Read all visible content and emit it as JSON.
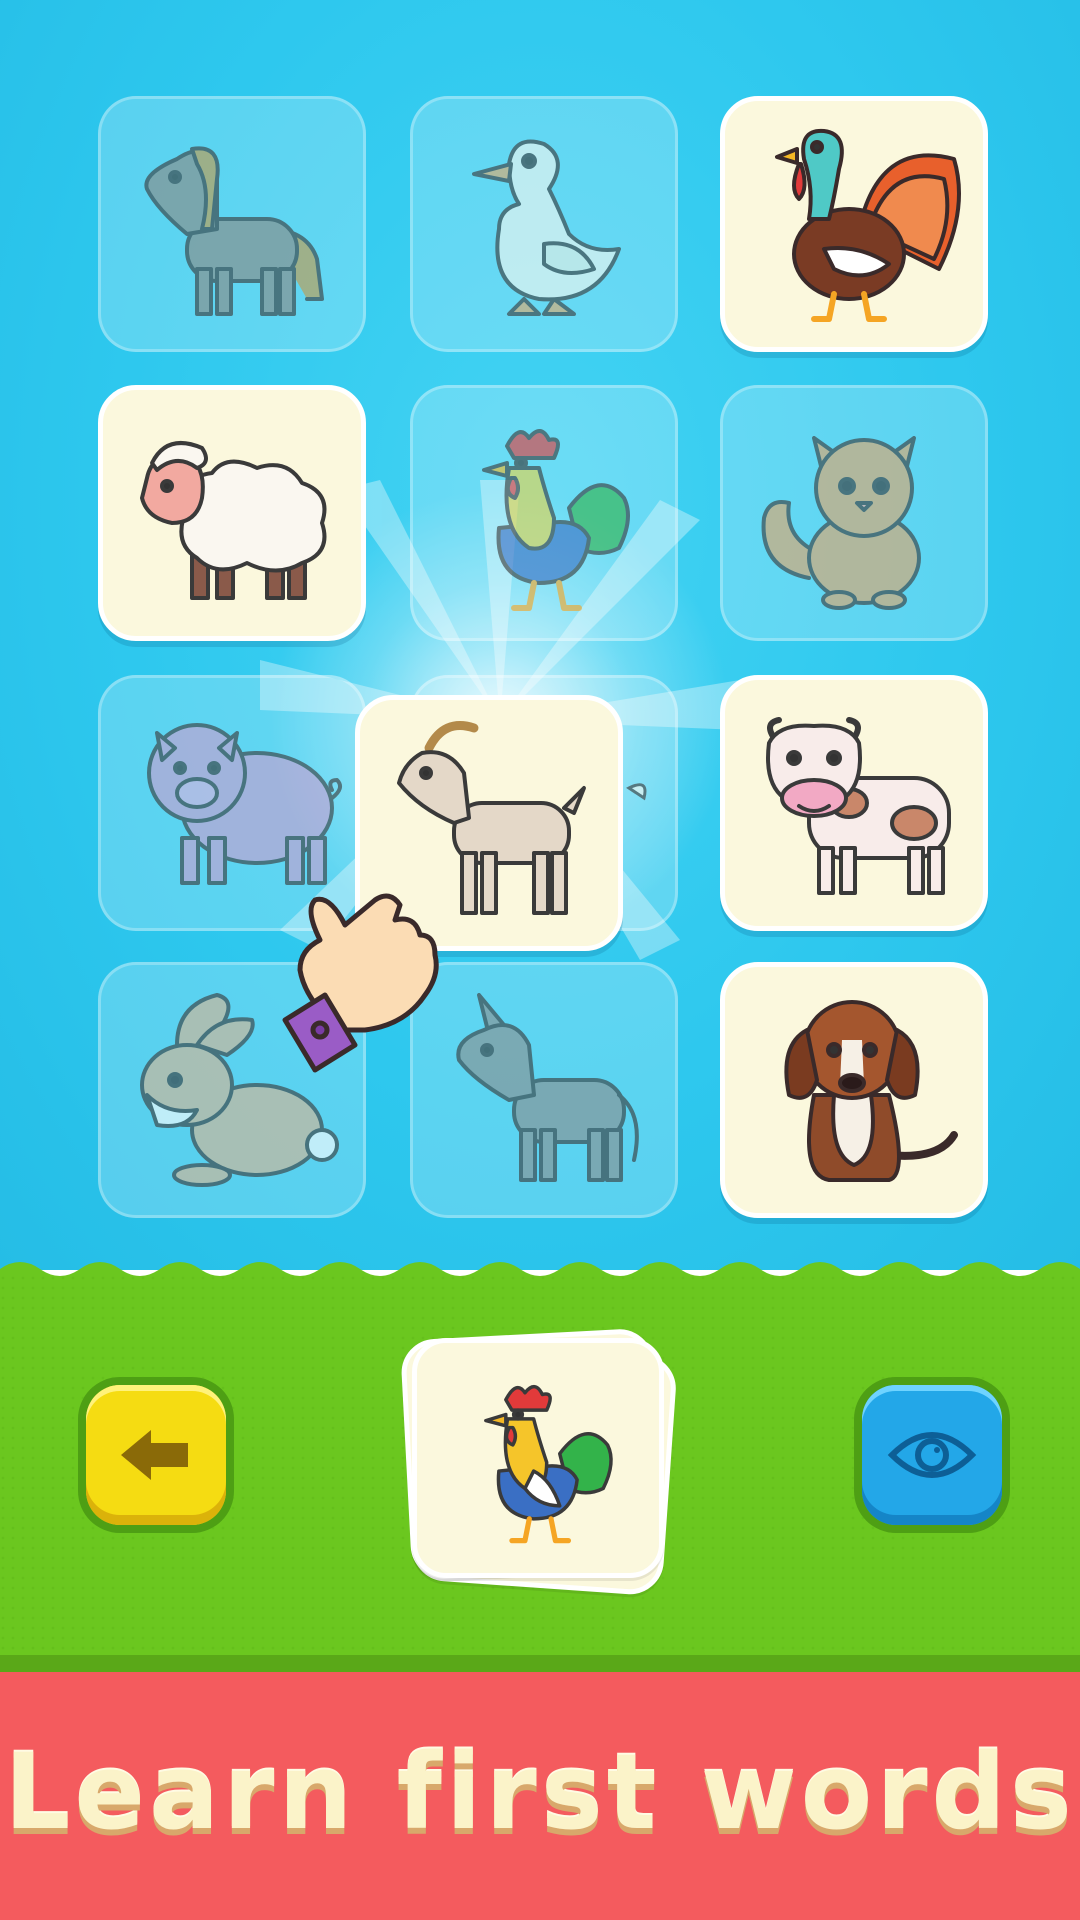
{
  "banner": {
    "text": "Learn first words"
  },
  "board": {
    "cards": [
      {
        "animal": "horse-icon",
        "state": "unmatched"
      },
      {
        "animal": "duck-icon",
        "state": "unmatched"
      },
      {
        "animal": "turkey-icon",
        "state": "matched"
      },
      {
        "animal": "sheep-icon",
        "state": "matched"
      },
      {
        "animal": "rooster-icon",
        "state": "unmatched"
      },
      {
        "animal": "cat-icon",
        "state": "unmatched"
      },
      {
        "animal": "pig-icon",
        "state": "unmatched"
      },
      {
        "animal": "goat-icon",
        "state": "dragging"
      },
      {
        "animal": "cow-icon",
        "state": "matched"
      },
      {
        "animal": "rabbit-icon",
        "state": "unmatched"
      },
      {
        "animal": "donkey-icon",
        "state": "unmatched"
      },
      {
        "animal": "dog-icon",
        "state": "matched"
      }
    ]
  },
  "target": {
    "animal": "rooster-icon"
  },
  "controls": {
    "back": "back-arrow-icon",
    "hint": "eye-icon"
  },
  "colors": {
    "sky": "#2ec8ee",
    "grass": "#6bc71f",
    "banner": "#f45b5e",
    "banner_text": "#fbf3c9",
    "card_matched": "#fbf8dd",
    "back_button": "#f5dc12",
    "hint_button": "#23a7e8"
  }
}
